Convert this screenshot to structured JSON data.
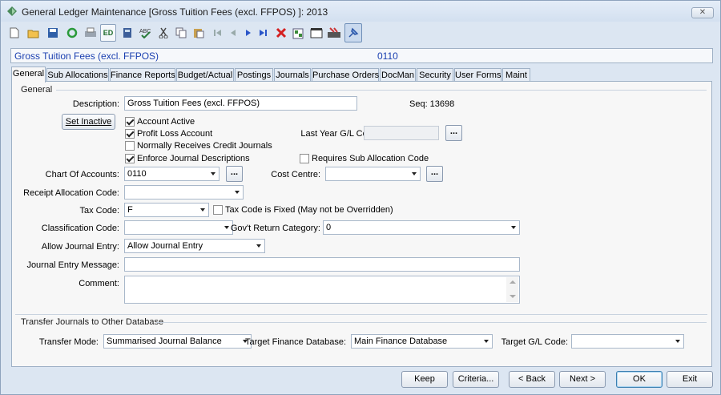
{
  "window": {
    "title": "General Ledger Maintenance  [Gross Tuition Fees (excl. FFPOS) ]:  2013",
    "close_glyph": "✕"
  },
  "toolbar": {
    "icons": [
      "new-document-icon",
      "open-folder-icon",
      "save-icon",
      "refresh-icon",
      "print-icon",
      "edit-icon",
      "calculator-icon",
      "spellcheck-icon",
      "cut-icon",
      "copy-icon",
      "paste-icon",
      "first-record-icon",
      "previous-record-icon",
      "next-record-icon",
      "last-record-icon",
      "delete-icon",
      "export-icon",
      "calendar-icon",
      "transfer-icon",
      "pin-icon"
    ],
    "edit_label": "ED"
  },
  "header": {
    "account_name": "Gross Tuition Fees (excl. FFPOS)",
    "account_code": "0110"
  },
  "tabs": [
    {
      "label": "General",
      "active": true
    },
    {
      "label": "Sub Allocations"
    },
    {
      "label": "Finance Reports"
    },
    {
      "label": "Budget/Actual"
    },
    {
      "label": "Postings"
    },
    {
      "label": "Journals"
    },
    {
      "label": "Purchase Orders"
    },
    {
      "label": "DocMan"
    },
    {
      "label": "Security"
    },
    {
      "label": "User Forms"
    },
    {
      "label": "Maint"
    }
  ],
  "general": {
    "group_label": "General",
    "description_label": "Description:",
    "description_value": "Gross Tuition Fees (excl. FFPOS)",
    "seq_label": "Seq: 13698",
    "set_inactive_label": "Set Inactive",
    "checkboxes": {
      "account_active": {
        "label": "Account Active",
        "checked": true
      },
      "profit_loss": {
        "label": "Profit Loss Account",
        "checked": true
      },
      "credit_journals": {
        "label": "Normally Receives Credit Journals",
        "checked": false
      },
      "enforce_desc": {
        "label": "Enforce Journal Descriptions",
        "checked": true
      },
      "requires_sub_alloc": {
        "label": "Requires Sub Allocation Code",
        "checked": false
      },
      "tax_fixed": {
        "label": "Tax Code is Fixed (May not be Overridden)",
        "checked": false
      }
    },
    "last_year_label": "Last Year G/L Code:",
    "last_year_value": "",
    "chart_of_accounts_label": "Chart Of Accounts:",
    "chart_of_accounts_value": "0110",
    "cost_centre_label": "Cost Centre:",
    "cost_centre_value": "",
    "receipt_alloc_label": "Receipt Allocation Code:",
    "receipt_alloc_value": "",
    "tax_code_label": "Tax Code:",
    "tax_code_value": "F",
    "classification_label": "Classification Code:",
    "classification_value": "",
    "govt_return_label": "Gov't Return Category:",
    "govt_return_value": "0",
    "allow_journal_label": "Allow Journal Entry:",
    "allow_journal_value": "Allow Journal Entry",
    "journal_msg_label": "Journal Entry Message:",
    "journal_msg_value": "",
    "comment_label": "Comment:",
    "comment_value": "",
    "ellipsis": "..."
  },
  "transfer": {
    "group_label": "Transfer Journals to Other Database",
    "mode_label": "Transfer Mode:",
    "mode_value": "Summarised Journal Balance",
    "target_db_label": "Target Finance Database:",
    "target_db_value": "Main Finance Database",
    "target_gl_label": "Target G/L Code:",
    "target_gl_value": ""
  },
  "footer": {
    "keep": "Keep",
    "criteria": "Criteria...",
    "back": "< Back",
    "next": "Next >",
    "ok": "OK",
    "exit": "Exit"
  },
  "colors": {
    "accent_text": "#1a3fb0",
    "window_bg": "#dce6f2",
    "panel_bg": "#f7f7f7"
  }
}
